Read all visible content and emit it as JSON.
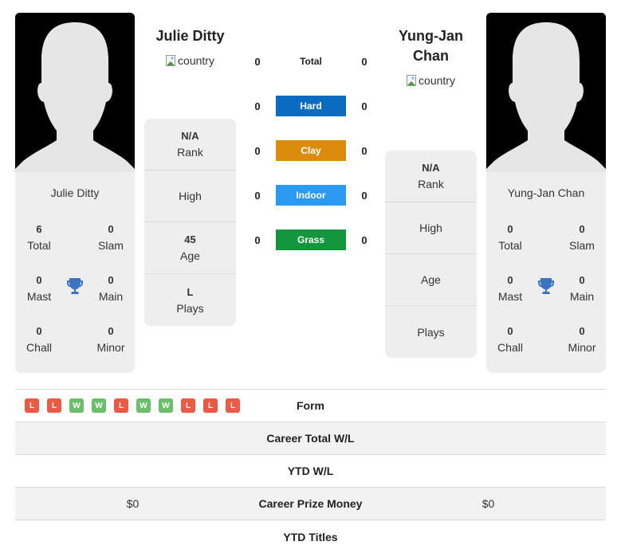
{
  "colors": {
    "hard": "#0a6cc1",
    "clay": "#db8c0b",
    "indoor": "#2b9af3",
    "grass": "#11963b",
    "win": "#6bbf6b",
    "loss": "#ea5a45",
    "trophy": "#3a74c0"
  },
  "player1": {
    "name": "Julie Ditty",
    "country_alt": "country",
    "card_name": "Julie Ditty",
    "stats": {
      "total": {
        "value": "6",
        "label": "Total"
      },
      "slam": {
        "value": "0",
        "label": "Slam"
      },
      "mast": {
        "value": "0",
        "label": "Mast"
      },
      "main": {
        "value": "0",
        "label": "Main"
      },
      "chall": {
        "value": "0",
        "label": "Chall"
      },
      "minor": {
        "value": "0",
        "label": "Minor"
      }
    },
    "info": {
      "rank": {
        "value": "N/A",
        "label": "Rank"
      },
      "high": {
        "value": "",
        "label": "High"
      },
      "age": {
        "value": "45",
        "label": "Age"
      },
      "plays": {
        "value": "L",
        "label": "Plays"
      }
    }
  },
  "player2": {
    "name": "Yung-Jan Chan",
    "country_alt": "country",
    "card_name": "Yung-Jan Chan",
    "stats": {
      "total": {
        "value": "0",
        "label": "Total"
      },
      "slam": {
        "value": "0",
        "label": "Slam"
      },
      "mast": {
        "value": "0",
        "label": "Mast"
      },
      "main": {
        "value": "0",
        "label": "Main"
      },
      "chall": {
        "value": "0",
        "label": "Chall"
      },
      "minor": {
        "value": "0",
        "label": "Minor"
      }
    },
    "info": {
      "rank": {
        "value": "N/A",
        "label": "Rank"
      },
      "high": {
        "value": "",
        "label": "High"
      },
      "age": {
        "value": "",
        "label": "Age"
      },
      "plays": {
        "value": "",
        "label": "Plays"
      }
    }
  },
  "surfaces": [
    {
      "label": "Total",
      "p1": "0",
      "p2": "0",
      "key": "total"
    },
    {
      "label": "Hard",
      "p1": "0",
      "p2": "0",
      "key": "hard"
    },
    {
      "label": "Clay",
      "p1": "0",
      "p2": "0",
      "key": "clay"
    },
    {
      "label": "Indoor",
      "p1": "0",
      "p2": "0",
      "key": "indoor"
    },
    {
      "label": "Grass",
      "p1": "0",
      "p2": "0",
      "key": "grass"
    }
  ],
  "form": {
    "label": "Form",
    "p1": [
      "L",
      "L",
      "W",
      "W",
      "L",
      "W",
      "W",
      "L",
      "L",
      "L"
    ]
  },
  "table_rows": [
    {
      "label": "Career Total W/L",
      "p1": "",
      "p2": ""
    },
    {
      "label": "YTD W/L",
      "p1": "",
      "p2": ""
    },
    {
      "label": "Career Prize Money",
      "p1": "$0",
      "p2": "$0"
    },
    {
      "label": "YTD Titles",
      "p1": "",
      "p2": ""
    }
  ]
}
